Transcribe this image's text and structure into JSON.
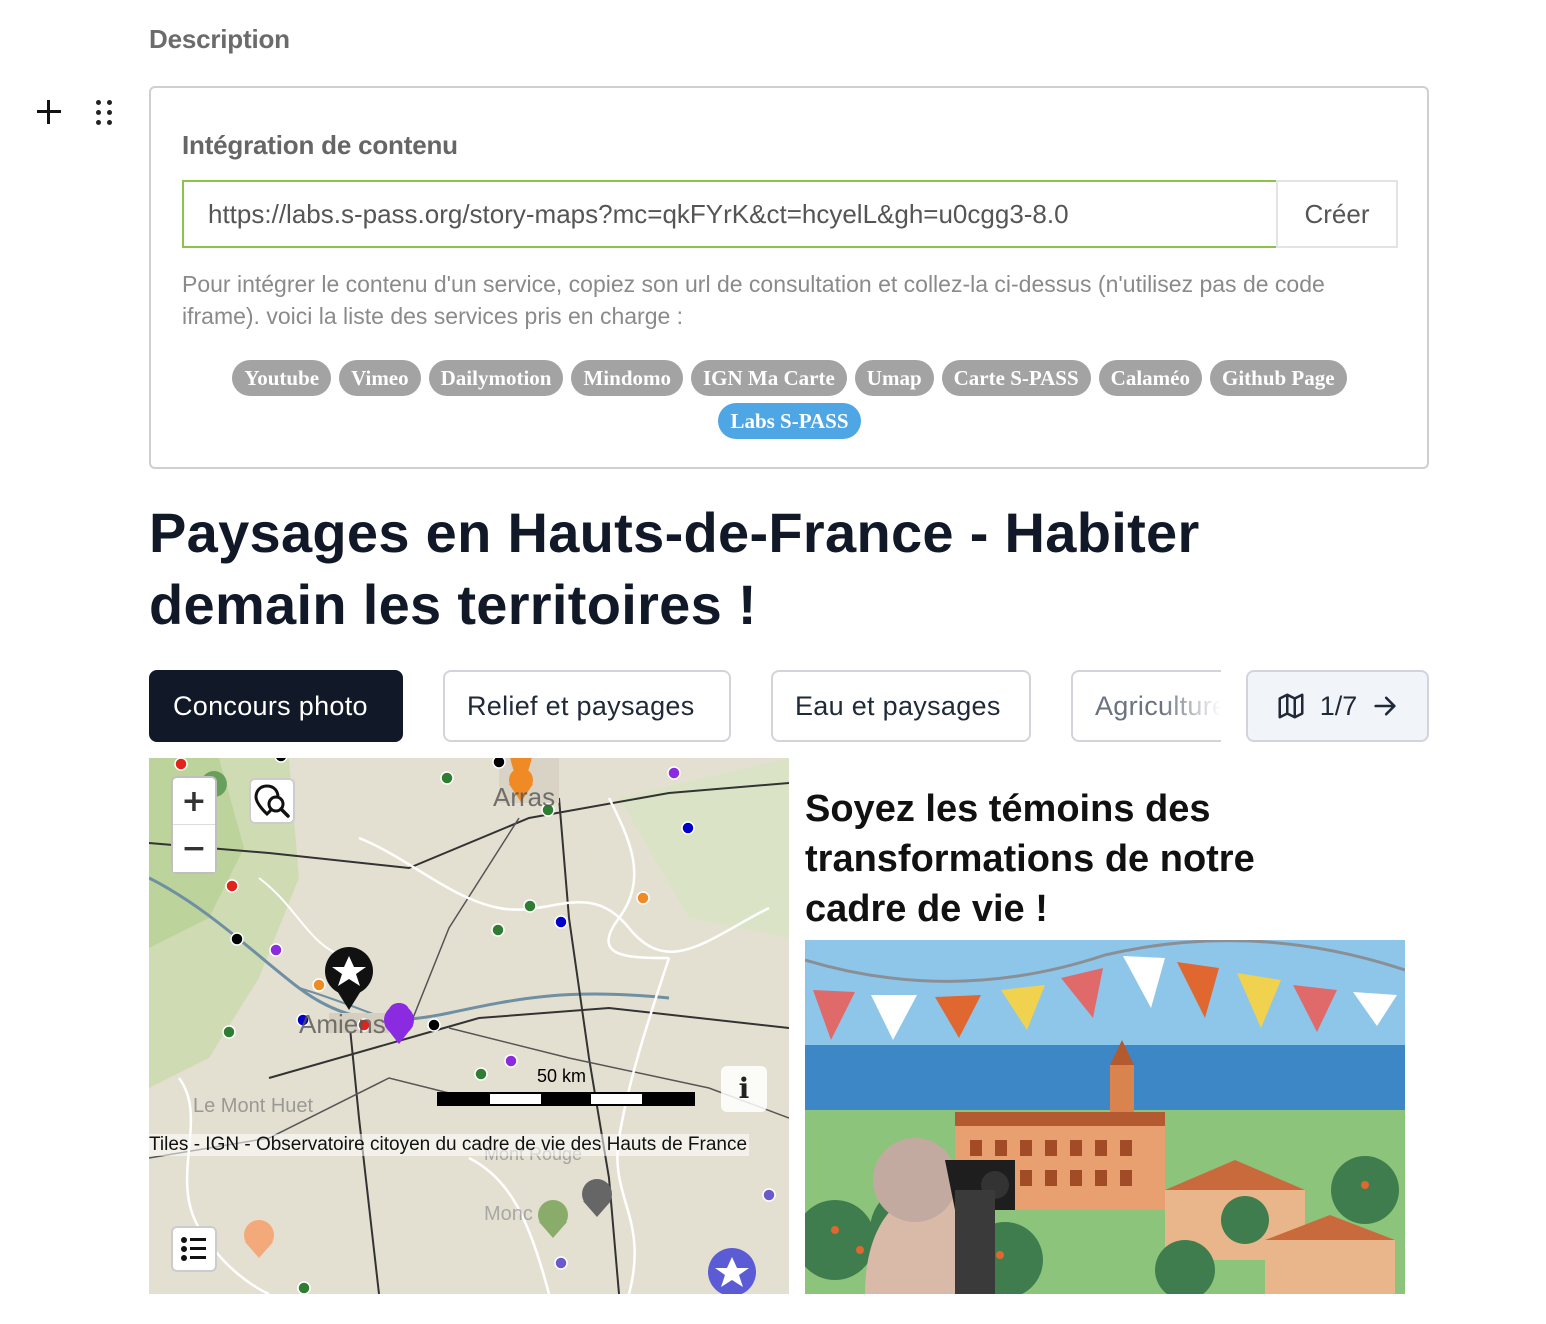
{
  "editor": {
    "description_label": "Description",
    "block": {
      "title": "Intégration de contenu",
      "url_value": "https://labs.s-pass.org/story-maps?mc=qkFYrK&ct=hcyelL&gh=u0cgg3-8.0",
      "create_label": "Créer",
      "help_text": "Pour intégrer le contenu d'un service, copiez son url de consultation et collez-la ci-dessus (n'utilisez pas de code iframe). voici la liste des services pris en charge :",
      "services": [
        "Youtube",
        "Vimeo",
        "Dailymotion",
        "Mindomo",
        "IGN Ma Carte",
        "Umap",
        "Carte S-PASS",
        "Calaméo",
        "Github Page",
        "Labs S-PASS"
      ],
      "active_service": "Labs S-PASS"
    }
  },
  "story": {
    "title": "Paysages en Hauts-de-France - Habiter demain les territoires !",
    "tabs": [
      "Concours photo",
      "Relief et paysages",
      "Eau et paysages",
      "Agriculture"
    ],
    "active_tab": "Concours photo",
    "pager": "1/7",
    "map": {
      "place_labels": [
        "Arras",
        "Amiens",
        "Le Mont Huet",
        "Mont Rouge",
        "Monc"
      ],
      "scale_label": "50 km",
      "info_label": "i",
      "attribution": "Tiles - IGN - Observatoire citoyen du cadre de vie des Hauts de France"
    },
    "section_title": "Soyez les témoins des transformations de notre cadre de vie !",
    "colors": {
      "active_tab": "#111827",
      "input_border": "#8bc34a",
      "active_service": "#4ea6e4",
      "service_tag": "#a3a3a3"
    }
  }
}
